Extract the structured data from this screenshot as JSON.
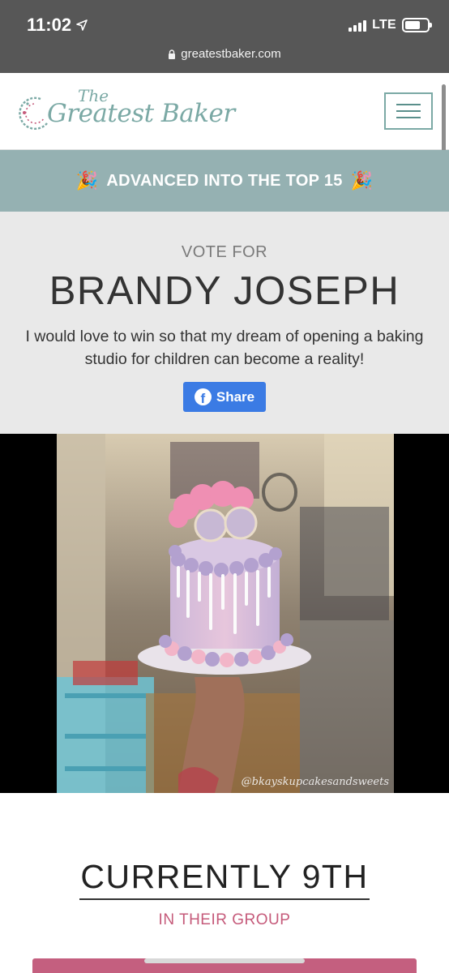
{
  "status_bar": {
    "time": "11:02",
    "network": "LTE",
    "icons": [
      "location-arrow-icon",
      "signal-icon",
      "battery-icon"
    ]
  },
  "browser": {
    "url": "greatestbaker.com",
    "icons": [
      "lock-icon"
    ]
  },
  "header": {
    "logo_top": "The",
    "logo_main": "Greatest Baker",
    "menu_icon": "hamburger-menu-icon"
  },
  "banner": {
    "text": "ADVANCED INTO THE TOP 15",
    "icon": "party-popper-icon"
  },
  "vote": {
    "prefix": "VOTE FOR",
    "name": "BRANDY JOSEPH",
    "quote": "I would love to win so that my dream of opening a baking studio for children can become a reality!",
    "share_label": "Share",
    "share_icon": "facebook-icon"
  },
  "photo": {
    "watermark": "@bkayskupcakesandsweets"
  },
  "ranking": {
    "title": "CURRENTLY 9TH",
    "subtitle": "IN THEIR GROUP"
  },
  "colors": {
    "brand_teal": "#7ba9a5",
    "banner_bg": "#95b1b2",
    "accent_pink": "#c55a7a",
    "facebook_blue": "#3b7be4"
  }
}
